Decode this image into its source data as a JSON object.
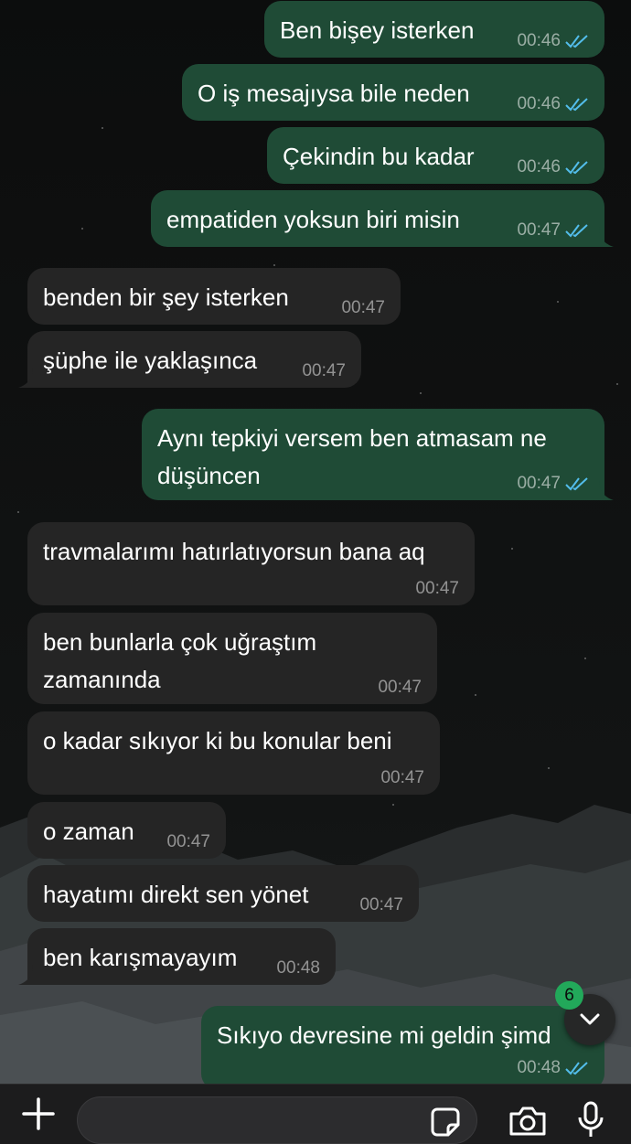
{
  "chat": {
    "messages": [
      {
        "direction": "out",
        "text": "Ben bişey isterken",
        "time": "00:46",
        "read": true
      },
      {
        "direction": "out",
        "text": "O iş mesajıysa bile neden",
        "time": "00:46",
        "read": true
      },
      {
        "direction": "out",
        "text": "Çekindin bu kadar",
        "time": "00:46",
        "read": true
      },
      {
        "direction": "out",
        "text": "empatiden yoksun biri misin",
        "time": "00:47",
        "read": true
      },
      {
        "direction": "in",
        "text": "benden bir şey isterken",
        "time": "00:47"
      },
      {
        "direction": "in",
        "text": "şüphe ile yaklaşınca",
        "time": "00:47"
      },
      {
        "direction": "out",
        "text": "Aynı tepkiyi versem ben atmasam ne\ndüşüncen",
        "time": "00:47",
        "read": true
      },
      {
        "direction": "in",
        "text": "travmalarımı hatırlatıyorsun bana aq",
        "time": "00:47"
      },
      {
        "direction": "in",
        "text": "ben bunlarla çok uğraştım\nzamanında",
        "time": "00:47"
      },
      {
        "direction": "in",
        "text": "o kadar sıkıyor ki bu konular beni",
        "time": "00:47"
      },
      {
        "direction": "in",
        "text": "o zaman",
        "time": "00:47"
      },
      {
        "direction": "in",
        "text": "hayatımı direkt sen yönet",
        "time": "00:47"
      },
      {
        "direction": "in",
        "text": "ben karışmayayım",
        "time": "00:48"
      },
      {
        "direction": "out",
        "text": "Sıkıyo devresine mi geldin şimd",
        "time": "00:48",
        "read": true
      }
    ]
  },
  "scroll_down": {
    "unread_count": "6",
    "icon": "chevron-down-icon"
  },
  "composer": {
    "plus_icon": "plus-icon",
    "input_value": "",
    "sticker_icon": "sticker-icon",
    "camera_icon": "camera-icon",
    "mic_icon": "microphone-icon"
  },
  "colors": {
    "outgoing_bubble": "#1f4b36",
    "incoming_bubble": "#252525",
    "read_ticks": "#53bdeb",
    "badge": "#22a85a",
    "composer_bg": "#1c1c1d"
  }
}
